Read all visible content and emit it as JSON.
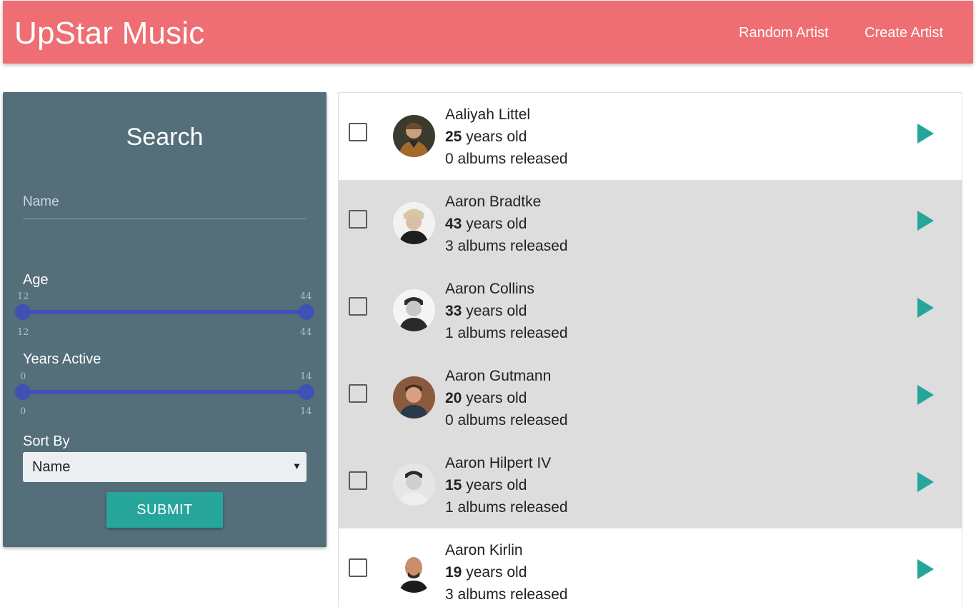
{
  "navbar": {
    "brand": "UpStar Music",
    "links": [
      "Random Artist",
      "Create Artist"
    ],
    "color": "#ef6e73"
  },
  "search": {
    "title": "Search",
    "name_placeholder": "Name",
    "name_value": "",
    "age": {
      "label": "Age",
      "min": "12",
      "max": "44"
    },
    "years_active": {
      "label": "Years Active",
      "min": "0",
      "max": "14"
    },
    "sort_by": {
      "label": "Sort By",
      "selected": "Name"
    },
    "submit_label": "SUBMIT",
    "panel_color": "#546e7a",
    "accent_color": "#26a69a",
    "slider_color": "#3f51b5"
  },
  "artists": [
    {
      "name": "Aaliyah Littel",
      "age": "25",
      "age_suffix": " years old",
      "albums": "0 albums released",
      "avatar_icon": "avatar-icon"
    },
    {
      "name": "Aaron Bradtke",
      "age": "43",
      "age_suffix": " years old",
      "albums": "3 albums released",
      "avatar_icon": "avatar-icon"
    },
    {
      "name": "Aaron Collins",
      "age": "33",
      "age_suffix": " years old",
      "albums": "1 albums released",
      "avatar_icon": "avatar-icon"
    },
    {
      "name": "Aaron Gutmann",
      "age": "20",
      "age_suffix": " years old",
      "albums": "0 albums released",
      "avatar_icon": "avatar-icon"
    },
    {
      "name": "Aaron Hilpert IV",
      "age": "15",
      "age_suffix": " years old",
      "albums": "1 albums released",
      "avatar_icon": "avatar-icon"
    },
    {
      "name": "Aaron Kirlin",
      "age": "19",
      "age_suffix": " years old",
      "albums": "3 albums released",
      "avatar_icon": "avatar-icon"
    }
  ],
  "play_icon": "play-arrow-icon"
}
